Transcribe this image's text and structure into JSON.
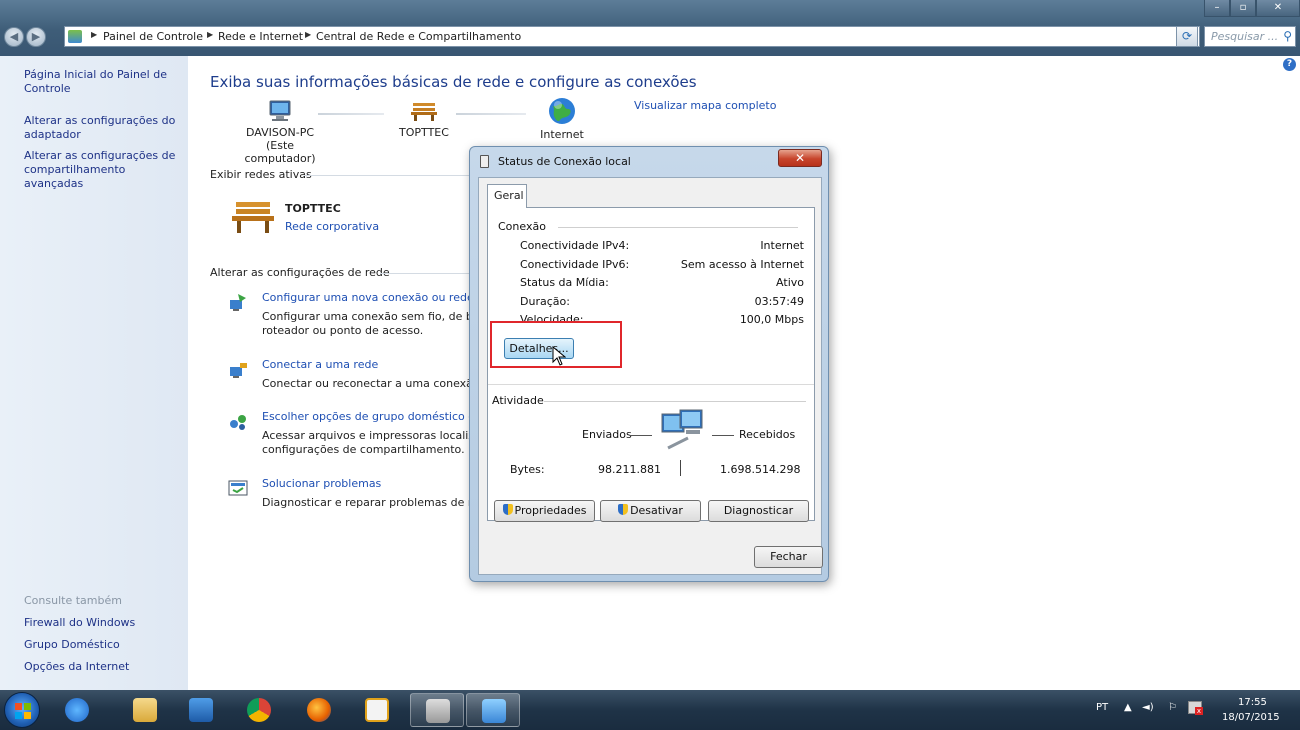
{
  "window": {
    "minimize": "–",
    "maximize": "▫",
    "close": "✕"
  },
  "address": {
    "crumbs": [
      "Painel de Controle",
      "Rede e Internet",
      "Central de Rede e Compartilhamento"
    ],
    "search_placeholder": "Pesquisar ..."
  },
  "sidebar": {
    "links": [
      "Página Inicial do Painel de Controle",
      "Alterar as configurações do adaptador",
      "Alterar as configurações de compartilhamento avançadas"
    ],
    "see_also_title": "Consulte também",
    "see_also": [
      "Firewall do Windows",
      "Grupo Doméstico",
      "Opções da Internet"
    ]
  },
  "main": {
    "heading": "Exiba suas informações básicas de rede e configure as conexões",
    "view_full_map": "Visualizar mapa completo",
    "map": {
      "computer_name": "DAVISON-PC",
      "computer_sub": "(Este computador)",
      "network_name": "TOPTTEC",
      "internet": "Internet"
    },
    "active_networks_title": "Exibir redes ativas",
    "active_network": {
      "name": "TOPTTEC",
      "type": "Rede corporativa"
    },
    "change_settings_title": "Alterar as configurações de rede",
    "tasks": [
      {
        "title": "Configurar uma nova conexão ou rede",
        "desc1": "Configurar uma conexão sem fio, de band",
        "desc2": "roteador ou ponto de acesso."
      },
      {
        "title": "Conectar a uma rede",
        "desc1": "Conectar ou reconectar a uma conexão di",
        "desc2": ""
      },
      {
        "title": "Escolher opções de grupo doméstico e de",
        "desc1": "Acessar arquivos e impressoras localizado",
        "desc2": "configurações de compartilhamento."
      },
      {
        "title": "Solucionar problemas",
        "desc1": "Diagnosticar e reparar problemas de rede",
        "desc2": ""
      }
    ]
  },
  "dialog": {
    "title": "Status de Conexão local",
    "close": "✕",
    "tab": "Geral",
    "connection_title": "Conexão",
    "rows": [
      {
        "label": "Conectividade IPv4:",
        "value": "Internet"
      },
      {
        "label": "Conectividade IPv6:",
        "value": "Sem acesso à Internet"
      },
      {
        "label": "Status da Mídia:",
        "value": "Ativo"
      },
      {
        "label": "Duração:",
        "value": "03:57:49"
      },
      {
        "label": "Velocidade:",
        "value": "100,0 Mbps"
      }
    ],
    "details_button": "Detalhes...",
    "activity_title": "Atividade",
    "sent_label": "Enviados",
    "received_label": "Recebidos",
    "bytes_label": "Bytes:",
    "bytes_sent": "98.211.881",
    "bytes_received": "1.698.514.298",
    "properties_button": "Propriedades",
    "disable_button": "Desativar",
    "diagnose_button": "Diagnosticar",
    "close_button": "Fechar"
  },
  "taskbar": {
    "language": "PT",
    "time": "17:55",
    "date": "18/07/2015"
  }
}
